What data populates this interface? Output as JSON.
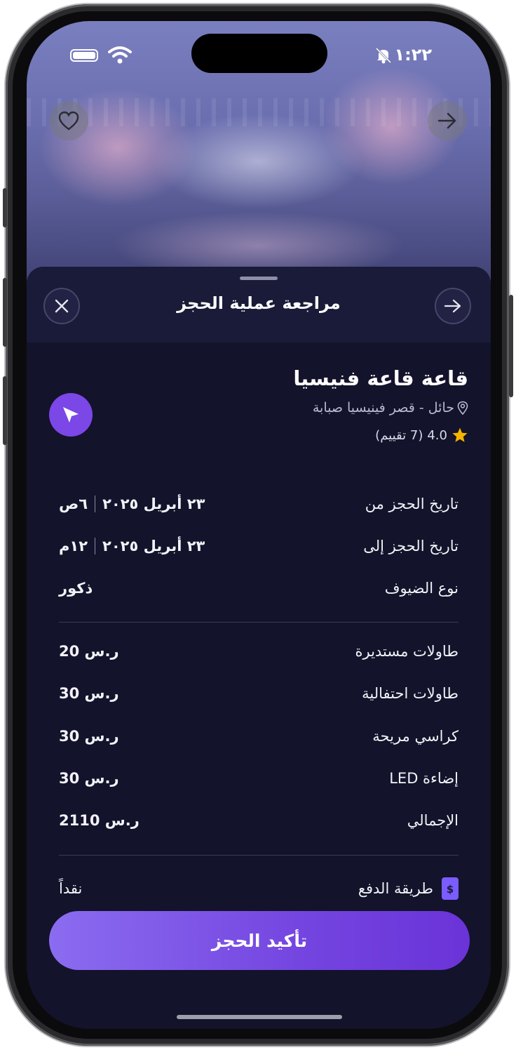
{
  "status": {
    "time": "١:٢٢"
  },
  "sheet": {
    "title": "مراجعة عملية الحجز"
  },
  "venue": {
    "name": "قاعة قاعة فنيسيا",
    "location": "حائل - قصر فينيسيا صبابة",
    "rating": "4.0",
    "reviews": "(7 تقييم)"
  },
  "details": [
    {
      "label": "تاريخ الحجز من",
      "date": "٢٣ أبريل ٢٠٢٥",
      "time": "٦ص"
    },
    {
      "label": "تاريخ الحجز إلى",
      "date": "٢٣ أبريل ٢٠٢٥",
      "time": "١٢م"
    },
    {
      "label": "نوع الضيوف",
      "value": "ذكور"
    }
  ],
  "prices": [
    {
      "label": "طاولات مستديرة",
      "value": "20 ر.س"
    },
    {
      "label": "طاولات احتفالية",
      "value": "30 ر.س"
    },
    {
      "label": "كراسي مريحة",
      "value": "30 ر.س"
    },
    {
      "label": "إضاءة LED",
      "value": "30 ر.س"
    },
    {
      "label": "الإجمالي",
      "value": "2110 ر.س"
    }
  ],
  "payment": {
    "label": "طريقة الدفع",
    "value": "نقداً"
  },
  "actions": {
    "confirm": "تأكيد الحجز"
  },
  "colors": {
    "accent": "#7b47e6",
    "background": "#13132b",
    "star": "#f5b400"
  },
  "icons": [
    "heart-icon",
    "arrow-right-icon",
    "close-icon",
    "navigation-icon",
    "location-pin-icon",
    "star-icon",
    "cash-icon"
  ]
}
